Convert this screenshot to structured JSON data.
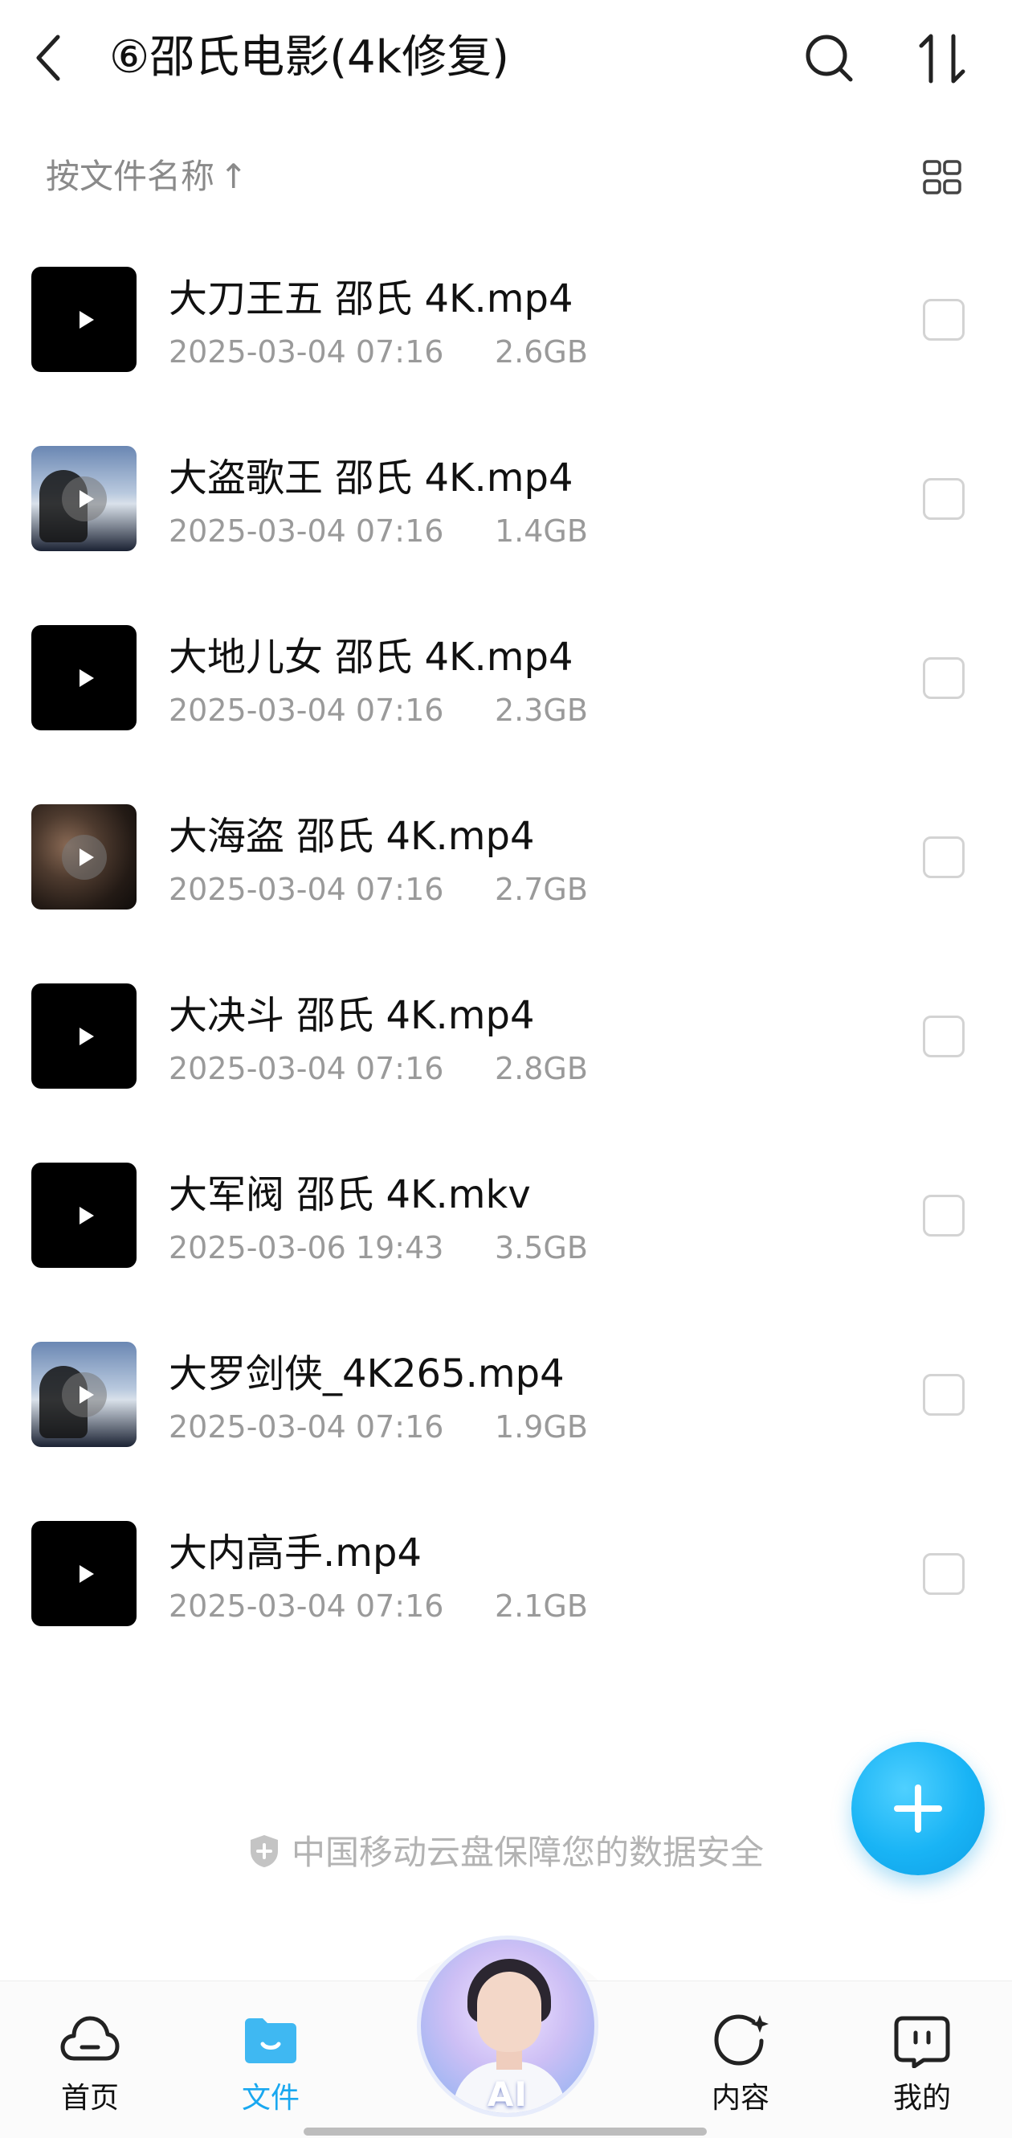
{
  "header": {
    "title": "⑥邵氏电影(4k修复)"
  },
  "sortbar": {
    "label": "按文件名称",
    "arrow": "↑"
  },
  "files": [
    {
      "name": "大刀王五  邵氏  4K.mp4",
      "date": "2025-03-04 07:16",
      "size": "2.6GB"
    },
    {
      "name": "大盗歌王  邵氏  4K.mp4",
      "date": "2025-03-04 07:16",
      "size": "1.4GB"
    },
    {
      "name": "大地儿女  邵氏  4K.mp4",
      "date": "2025-03-04 07:16",
      "size": "2.3GB"
    },
    {
      "name": "大海盗  邵氏  4K.mp4",
      "date": "2025-03-04 07:16",
      "size": "2.7GB"
    },
    {
      "name": "大决斗  邵氏  4K.mp4",
      "date": "2025-03-04 07:16",
      "size": "2.8GB"
    },
    {
      "name": "大军阀  邵氏  4K.mkv",
      "date": "2025-03-06 19:43",
      "size": "3.5GB"
    },
    {
      "name": "大罗剑侠_4K265.mp4",
      "date": "2025-03-04 07:16",
      "size": "1.9GB"
    },
    {
      "name": "大内高手.mp4",
      "date": "2025-03-04 07:16",
      "size": "2.1GB"
    }
  ],
  "footer_note": "中国移动云盘保障您的数据安全",
  "tabbar": {
    "home": "首页",
    "files": "文件",
    "ai": "AI",
    "content": "内容",
    "mine": "我的"
  },
  "colors": {
    "accent": "#19a8f0",
    "secondary_text": "#9a9a9a"
  }
}
